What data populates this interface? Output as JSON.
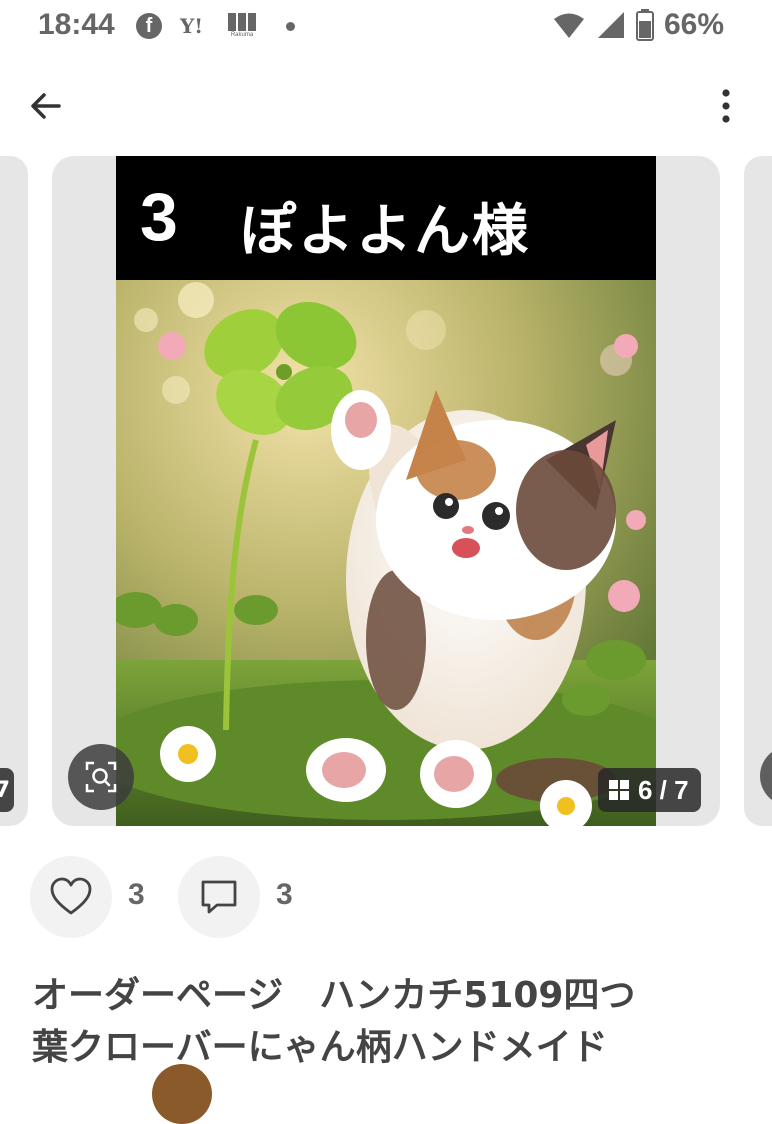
{
  "status_bar": {
    "time": "18:44",
    "battery": "66%",
    "notif_icons": [
      "facebook-icon",
      "yahoo-icon",
      "rakuma-icon",
      "dot-icon"
    ],
    "yahoo_text": "Y!",
    "rakuma_text": "Rakuma"
  },
  "app_bar": {
    "back_icon": "arrow-left-icon",
    "more_icon": "more-vertical-icon"
  },
  "carousel": {
    "prev_counter_fragment": "7",
    "image": {
      "number": "3",
      "name": "ぽよよん様"
    },
    "counter": "6 / 7"
  },
  "actions": {
    "like_count": "3",
    "comment_count": "3"
  },
  "item": {
    "title_line1": "オーダーページ　ハンカチ5109四つ",
    "title_line2": "葉クローバーにゃん柄ハンドメイド"
  },
  "colors": {
    "icon_gray": "#666666",
    "card_bg": "#e6e6e6",
    "action_bg": "#f2f2f2"
  }
}
